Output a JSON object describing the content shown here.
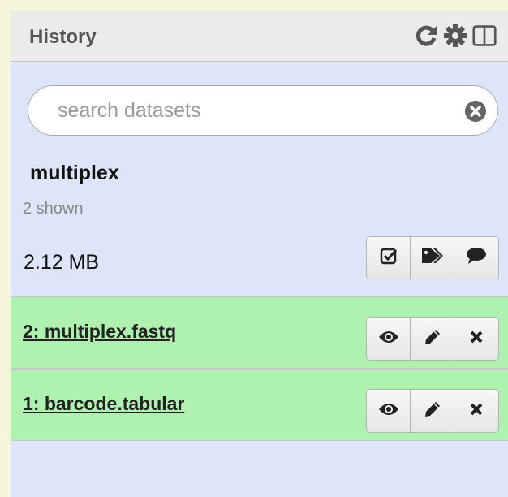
{
  "header": {
    "title": "History",
    "icons": [
      "refresh-icon",
      "gear-icon",
      "columns-icon"
    ]
  },
  "search": {
    "placeholder": "search datasets",
    "value": ""
  },
  "history": {
    "name": "multiplex",
    "shown": "2 shown",
    "size": "2.12 MB",
    "actions": [
      "check-square-icon",
      "tags-icon",
      "comment-icon"
    ]
  },
  "datasets": [
    {
      "title": "2: multiplex.fastq"
    },
    {
      "title": "1: barcode.tabular"
    }
  ],
  "colors": {
    "page_background": "#f5f5dc",
    "panel_background": "#dfe5f9",
    "header_background": "#ebebeb",
    "dataset_ok": "#aff1af"
  }
}
